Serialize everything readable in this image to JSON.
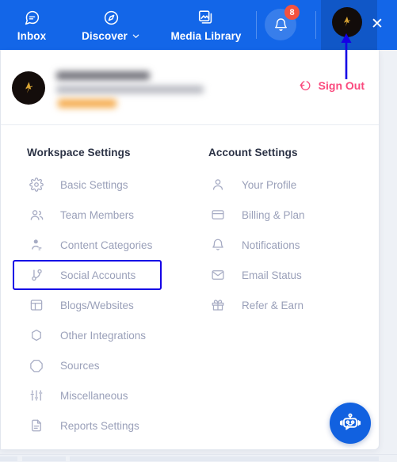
{
  "topnav": {
    "background": "#1366e8",
    "items": [
      {
        "label": "Inbox",
        "icon": "chat-bubble-icon"
      },
      {
        "label": "Discover",
        "icon": "compass-icon",
        "chevron": "⌄"
      },
      {
        "label": "Media Library",
        "icon": "media-images-icon"
      }
    ],
    "notification": {
      "icon": "bell-icon",
      "badge": "8",
      "badge_color": "#f4523f"
    },
    "avatar": {
      "icon": "user-avatar-logo",
      "background": "#120c0a",
      "mark_color": "#d9a534"
    },
    "close": {
      "icon": "close-icon",
      "label": "✕"
    }
  },
  "profile": {
    "avatar_icon": "user-avatar-logo",
    "name_redacted": "",
    "email_redacted": "",
    "badge_redacted": "",
    "sign_out": {
      "label": "Sign Out",
      "icon": "sign-out-icon",
      "color": "#fa4a7e"
    }
  },
  "workspace_settings": {
    "title": "Workspace Settings",
    "items": [
      {
        "label": "Basic Settings",
        "icon": "gear-icon",
        "highlighted": false
      },
      {
        "label": "Team Members",
        "icon": "users-icon",
        "highlighted": false
      },
      {
        "label": "Content Categories",
        "icon": "person-tag-icon",
        "highlighted": false
      },
      {
        "label": "Social Accounts",
        "icon": "share-branch-icon",
        "highlighted": true
      },
      {
        "label": "Blogs/Websites",
        "icon": "layout-panel-icon",
        "highlighted": false
      },
      {
        "label": "Other Integrations",
        "icon": "hexagon-icon",
        "highlighted": false
      },
      {
        "label": "Sources",
        "icon": "octagon-icon",
        "highlighted": false
      },
      {
        "label": "Miscellaneous",
        "icon": "sliders-icon",
        "highlighted": false
      },
      {
        "label": "Reports Settings",
        "icon": "document-icon",
        "highlighted": false
      }
    ]
  },
  "account_settings": {
    "title": "Account Settings",
    "items": [
      {
        "label": "Your Profile",
        "icon": "person-icon"
      },
      {
        "label": "Billing & Plan",
        "icon": "credit-card-icon"
      },
      {
        "label": "Notifications",
        "icon": "bell-icon"
      },
      {
        "label": "Email Status",
        "icon": "envelope-icon"
      },
      {
        "label": "Refer & Earn",
        "icon": "gift-icon"
      }
    ]
  },
  "chat_widget": {
    "icon": "robot-icon",
    "background": "#1161e0"
  },
  "annotation": {
    "type": "arrow-up",
    "color": "#1400e6",
    "points_to": "nav-avatar"
  },
  "highlight": {
    "color": "#1400e6",
    "target": "Social Accounts"
  }
}
